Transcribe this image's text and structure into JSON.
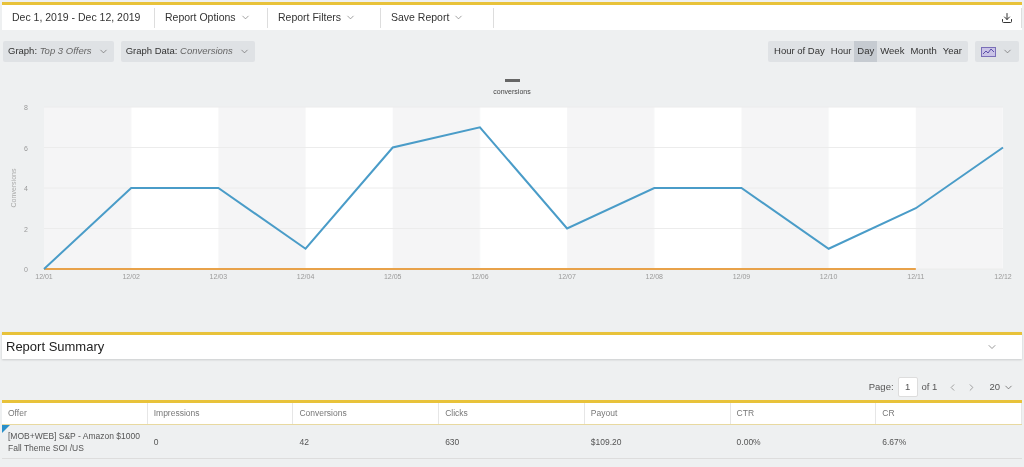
{
  "toolbar": {
    "menus": [
      {
        "label": "Dec 1, 2019 - Dec 12, 2019"
      },
      {
        "label": "Report Options"
      },
      {
        "label": "Report Filters"
      },
      {
        "label": "Save Report"
      }
    ]
  },
  "graph_controls": [
    {
      "label": "Graph:",
      "value": "Top 3 Offers"
    },
    {
      "label": "Graph Data:",
      "value": "Conversions"
    }
  ],
  "periods": [
    {
      "label": "Hour of Day",
      "selected": false
    },
    {
      "label": "Hour",
      "selected": false
    },
    {
      "label": "Day",
      "selected": true
    },
    {
      "label": "Week",
      "selected": false
    },
    {
      "label": "Month",
      "selected": false
    },
    {
      "label": "Year",
      "selected": false
    }
  ],
  "chart": {
    "chart_data": {
      "type": "line",
      "grid": true,
      "ylabel": "Conversions",
      "categories": [
        "12/01",
        "12/02",
        "12/03",
        "12/04",
        "12/05",
        "12/06",
        "12/07",
        "12/08",
        "12/09",
        "12/10",
        "12/11",
        "12/12"
      ],
      "ylim": [
        0,
        8
      ],
      "yticks": [
        0,
        2,
        4,
        6,
        8
      ],
      "series": [
        {
          "name": "conversions",
          "color": "#4a9cc8",
          "values": [
            0,
            4,
            4,
            1,
            6,
            7,
            2,
            4,
            4,
            1,
            3,
            6
          ]
        },
        {
          "color": "#e8a24a",
          "values": [
            0,
            0,
            0,
            0,
            0,
            0,
            0,
            0,
            0,
            0,
            0,
            null
          ]
        }
      ]
    }
  },
  "summary": {
    "title": "Report Summary"
  },
  "pagination": {
    "label": "Page:",
    "page": "1",
    "of": "of 1",
    "per_page": "20"
  },
  "table": {
    "columns": [
      "Offer",
      "Impressions",
      "Conversions",
      "Clicks",
      "Payout",
      "CTR",
      "CR"
    ],
    "rows": [
      {
        "color": "#2a8fc9",
        "cells": [
          "[MOB+WEB] S&P - Amazon $1000 Fall Theme SOI /US",
          "0",
          "42",
          "630",
          "$109.20",
          "0.00%",
          "6.67%"
        ]
      }
    ]
  }
}
